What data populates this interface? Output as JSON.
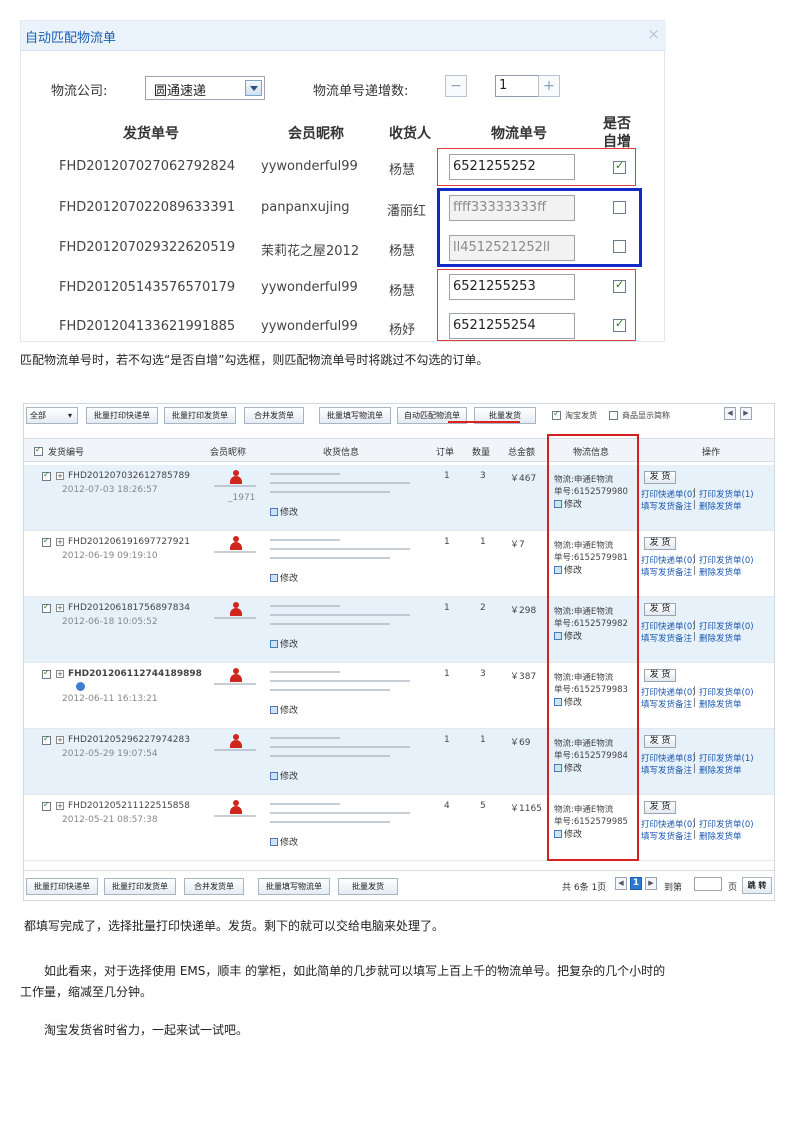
{
  "dialog": {
    "title": "自动匹配物流单",
    "close_icon": "×",
    "company_label": "物流公司:",
    "company_value": "圆通速递",
    "increment_label": "物流单号递增数:",
    "minus": "−",
    "increment_value": "1",
    "plus": "+",
    "headers": {
      "order_no": "发货单号",
      "member": "会员昵称",
      "receiver": "收货人",
      "tracking": "物流单号",
      "auto_inc_line1": "是否",
      "auto_inc_line2": "自增"
    },
    "rows": [
      {
        "order_no": "FHD201207027062792824",
        "member": "yywonderful99",
        "receiver": "杨慧",
        "tracking": "6521255252",
        "auto": true
      },
      {
        "order_no": "FHD201207022089633391",
        "member": "panpanxujing",
        "receiver": "潘丽红",
        "tracking": "ffff33333333ff",
        "auto": false
      },
      {
        "order_no": "FHD201207029322620519",
        "member": "茉莉花之屋2012",
        "receiver": "杨慧",
        "tracking": "ll4512521252ll",
        "auto": false
      },
      {
        "order_no": "FHD201205143576570179",
        "member": "yywonderful99",
        "receiver": "杨慧",
        "tracking": "6521255253",
        "auto": true
      },
      {
        "order_no": "FHD201204133621991885",
        "member": "yywonderful99",
        "receiver": "杨妤",
        "tracking": "6521255254",
        "auto": true
      }
    ]
  },
  "text1": "匹配物流单号时，若不勾选“是否自增”勾选框，则匹配物流单号时将跳过不勾选的订单。",
  "orders": {
    "filter_value": "全部",
    "toolbar": [
      "批量打印快递单",
      "批量打印发货单",
      "合并发货单",
      "批量填写物流单",
      "自动匹配物流单",
      "批量发货"
    ],
    "taobao_label": "淘宝发货",
    "taobao_checked": true,
    "short_name_label": "商品显示简称",
    "short_name_checked": false,
    "headers": {
      "order_no": "发货编号",
      "member": "会员昵称",
      "shipping": "收货信息",
      "order_count": "订单",
      "quantity": "数量",
      "total": "总金额",
      "logistics": "物流信息",
      "actions": "操作"
    },
    "edit_label": "修改",
    "ship_label": "发 货",
    "fill_note_label": "填写发货备注",
    "delete_label": "删除发货单",
    "rows": [
      {
        "order_no": "FHD20120703261278578​9",
        "date": "2012-07-03 18:26:57",
        "member_tag": "_1971",
        "orders": "1",
        "qty": "3",
        "total": "￥467",
        "carrier": "物流:申通E物流",
        "tracking": "单号:6152579980",
        "print_express": "打印快递单(0)",
        "print_invoice": "打印发货单(1)",
        "bold": false
      },
      {
        "order_no": "FHD201206191697727921",
        "date": "2012-06-19 09:19:10",
        "member_tag": "",
        "orders": "1",
        "qty": "1",
        "total": "￥7",
        "carrier": "物流:申通E物流",
        "tracking": "单号:6152579981",
        "print_express": "打印快递单(0)",
        "print_invoice": "打印发货单(0)",
        "bold": false
      },
      {
        "order_no": "FHD201206181756897834",
        "date": "2012-06-18 10:05:52",
        "member_tag": "",
        "orders": "1",
        "qty": "2",
        "total": "￥298",
        "carrier": "物流:申通E物流",
        "tracking": "单号:6152579982",
        "print_express": "打印快递单(0)",
        "print_invoice": "打印发货单(0)",
        "bold": false
      },
      {
        "order_no": "FHD201206112744189898",
        "date": "2012-06-11 16:13:21",
        "member_tag": "",
        "orders": "1",
        "qty": "3",
        "total": "￥387",
        "carrier": "物流:申通E物流",
        "tracking": "单号:6152579983",
        "print_express": "打印快递单(0)",
        "print_invoice": "打印发货单(0)",
        "bold": true
      },
      {
        "order_no": "FHD201205296227974283",
        "date": "2012-05-29 19:07:54",
        "member_tag": "",
        "orders": "1",
        "qty": "1",
        "total": "￥69",
        "carrier": "物流:申通E物流",
        "tracking": "单号:6152579984",
        "print_express": "打印快递单(8)",
        "print_invoice": "打印发货单(1)",
        "bold": false
      },
      {
        "order_no": "FHD201205211122515858",
        "date": "2012-05-21 08:57:38",
        "member_tag": "",
        "orders": "4",
        "qty": "5",
        "total": "￥1165",
        "carrier": "物流:申通E物流",
        "tracking": "单号:6152579985",
        "print_express": "打印快递单(0)",
        "print_invoice": "打印发货单(0)",
        "bold": false
      }
    ],
    "footer_buttons": [
      "批量打印快递单",
      "批量打印发货单",
      "合并发货单",
      "批量填写物流单",
      "批量发货"
    ],
    "pagination": {
      "summary": "共 6条 1页",
      "current": "1",
      "goto_label": "到第",
      "page_suffix": "页",
      "jump": "跳 转"
    }
  },
  "text2": "都填写完成了，选择批量打印快递单。发货。剩下的就可以交给电脑来处理了。",
  "text3_line1": "如此看来，对于选择使用 EMS，顺丰 的掌柜，如此简单的几步就可以填写上百上千的物流单号。把复杂的几个小时的",
  "text3_line2": "工作量，缩减至几分钟。",
  "text4": "淘宝发货省时省力，一起来试一试吧。"
}
